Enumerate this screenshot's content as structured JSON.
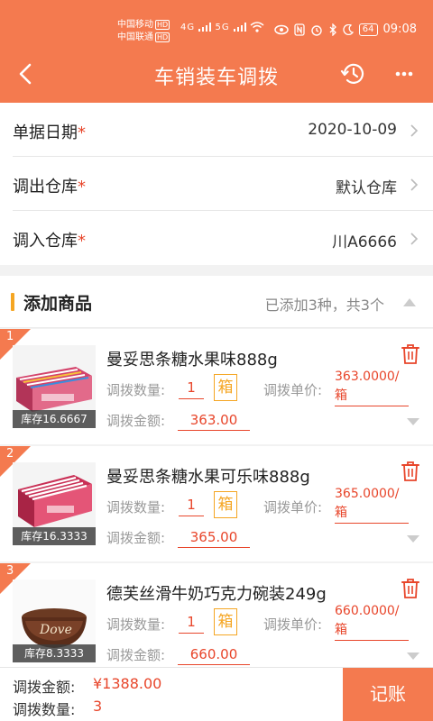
{
  "status_bar": {
    "carrier1": "中国移动",
    "carrier2": "中国联通",
    "hd": "HD",
    "signal_a": "4G",
    "signal_b": "5G",
    "battery": "64",
    "time": "09:08"
  },
  "nav": {
    "title": "车销装车调拨",
    "back_icon": "chevron-left-icon",
    "history_icon": "history-clock-icon",
    "more_icon": "more-dots-icon"
  },
  "form": {
    "required_mark": "*",
    "fields": [
      {
        "label": "单据日期",
        "value": "2020-10-09"
      },
      {
        "label": "调出仓库",
        "value": "默认仓库"
      },
      {
        "label": "调入仓库",
        "value": "川A6666"
      }
    ]
  },
  "section": {
    "title": "添加商品",
    "summary": "已添加3种，共3个"
  },
  "items": [
    {
      "index": "1",
      "name": "曼妥思条糖水果味888g",
      "stock": "库存16.6667",
      "qty_label": "调拨数量:",
      "qty": "1",
      "unit": "箱",
      "price_label": "调拨单价:",
      "price": "363.0000/箱",
      "amount_label": "调拨金额:",
      "amount": "363.00"
    },
    {
      "index": "2",
      "name": "曼妥思条糖水果可乐味888g",
      "stock": "库存16.3333",
      "qty_label": "调拨数量:",
      "qty": "1",
      "unit": "箱",
      "price_label": "调拨单价:",
      "price": "365.0000/箱",
      "amount_label": "调拨金额:",
      "amount": "365.00"
    },
    {
      "index": "3",
      "name": "德芙丝滑牛奶巧克力碗装249g",
      "stock": "库存8.3333",
      "qty_label": "调拨数量:",
      "qty": "1",
      "unit": "箱",
      "price_label": "调拨单价:",
      "price": "660.0000/箱",
      "amount_label": "调拨金额:",
      "amount": "660.00"
    }
  ],
  "footer": {
    "amount_label": "调拨金额:",
    "amount": "¥1388.00",
    "qty_label": "调拨数量:",
    "qty": "3",
    "submit": "记账"
  },
  "colors": {
    "brand": "#f47a4f",
    "accent": "#f5a623",
    "price": "#e8462b"
  }
}
